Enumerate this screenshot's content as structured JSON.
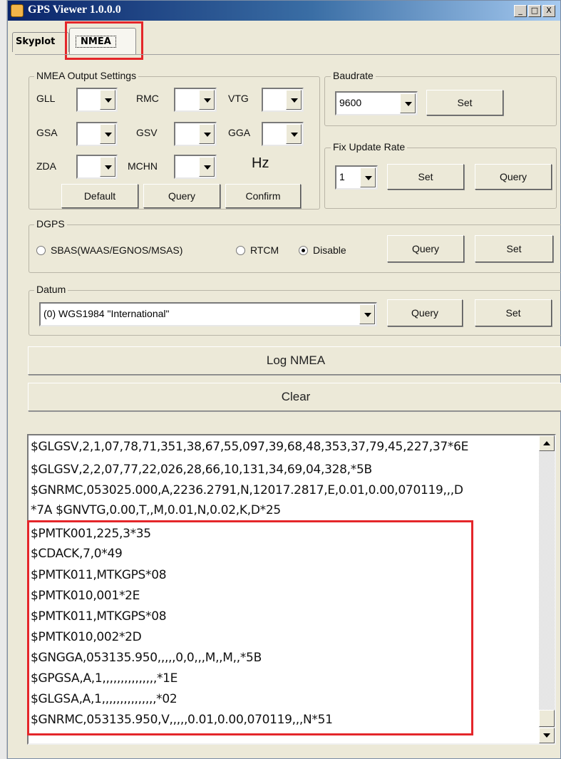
{
  "window": {
    "title": "GPS Viewer 1.0.0.0",
    "minimize": "_",
    "restore": "□",
    "close": "X"
  },
  "tabs": [
    {
      "label": "Skyplot"
    },
    {
      "label": "NMEA"
    }
  ],
  "nmea_output": {
    "legend": "NMEA Output Settings",
    "fields": [
      {
        "label": "GLL",
        "value": ""
      },
      {
        "label": "RMC",
        "value": ""
      },
      {
        "label": "VTG",
        "value": ""
      },
      {
        "label": "GSA",
        "value": ""
      },
      {
        "label": "GSV",
        "value": ""
      },
      {
        "label": "GGA",
        "value": ""
      },
      {
        "label": "ZDA",
        "value": ""
      },
      {
        "label": "MCHN",
        "value": ""
      }
    ],
    "unit": "Hz",
    "buttons": {
      "default": "Default",
      "query": "Query",
      "confirm": "Confirm"
    }
  },
  "baudrate": {
    "legend": "Baudrate",
    "value": "9600",
    "set": "Set"
  },
  "fix_update": {
    "legend": "Fix Update Rate",
    "value": "1",
    "set": "Set",
    "query": "Query"
  },
  "dgps": {
    "legend": "DGPS",
    "options": [
      {
        "label": "SBAS(WAAS/EGNOS/MSAS)",
        "checked": false
      },
      {
        "label": "RTCM",
        "checked": false
      },
      {
        "label": "Disable",
        "checked": true
      }
    ],
    "query": "Query",
    "set": "Set"
  },
  "datum": {
    "legend": "Datum",
    "value": "(0) WGS1984 \"International\"",
    "query": "Query",
    "set": "Set"
  },
  "actions": {
    "log": "Log NMEA",
    "clear": "Clear"
  },
  "log_lines": [
    "$GLGSV,2,1,07,78,71,351,38,67,55,097,39,68,48,353,37,79,45,227,37*6E",
    "$GLGSV,2,2,07,77,22,026,28,66,10,131,34,69,04,328,*5B",
    "$GNRMC,053025.000,A,2236.2791,N,12017.2817,E,0.01,0.00,070119,,,D",
    "*7A $GNVTG,0.00,T,,M,0.01,N,0.02,K,D*25",
    "$PMTK001,225,3*35",
    "$CDACK,7,0*49",
    "$PMTK011,MTKGPS*08",
    "$PMTK010,001*2E",
    "$PMTK011,MTKGPS*08",
    "$PMTK010,002*2D",
    "$GNGGA,053135.950,,,,,0,0,,,M,,M,,*5B",
    "$GPGSA,A,1,,,,,,,,,,,,,,,*1E",
    "$GLGSA,A,1,,,,,,,,,,,,,,,*02",
    "$GNRMC,053135.950,V,,,,,0.01,0.00,070119,,,N*51"
  ],
  "colors": {
    "highlight": "#e4262a",
    "window_bg": "#ece9d8",
    "titlebar": "#0a246a"
  }
}
